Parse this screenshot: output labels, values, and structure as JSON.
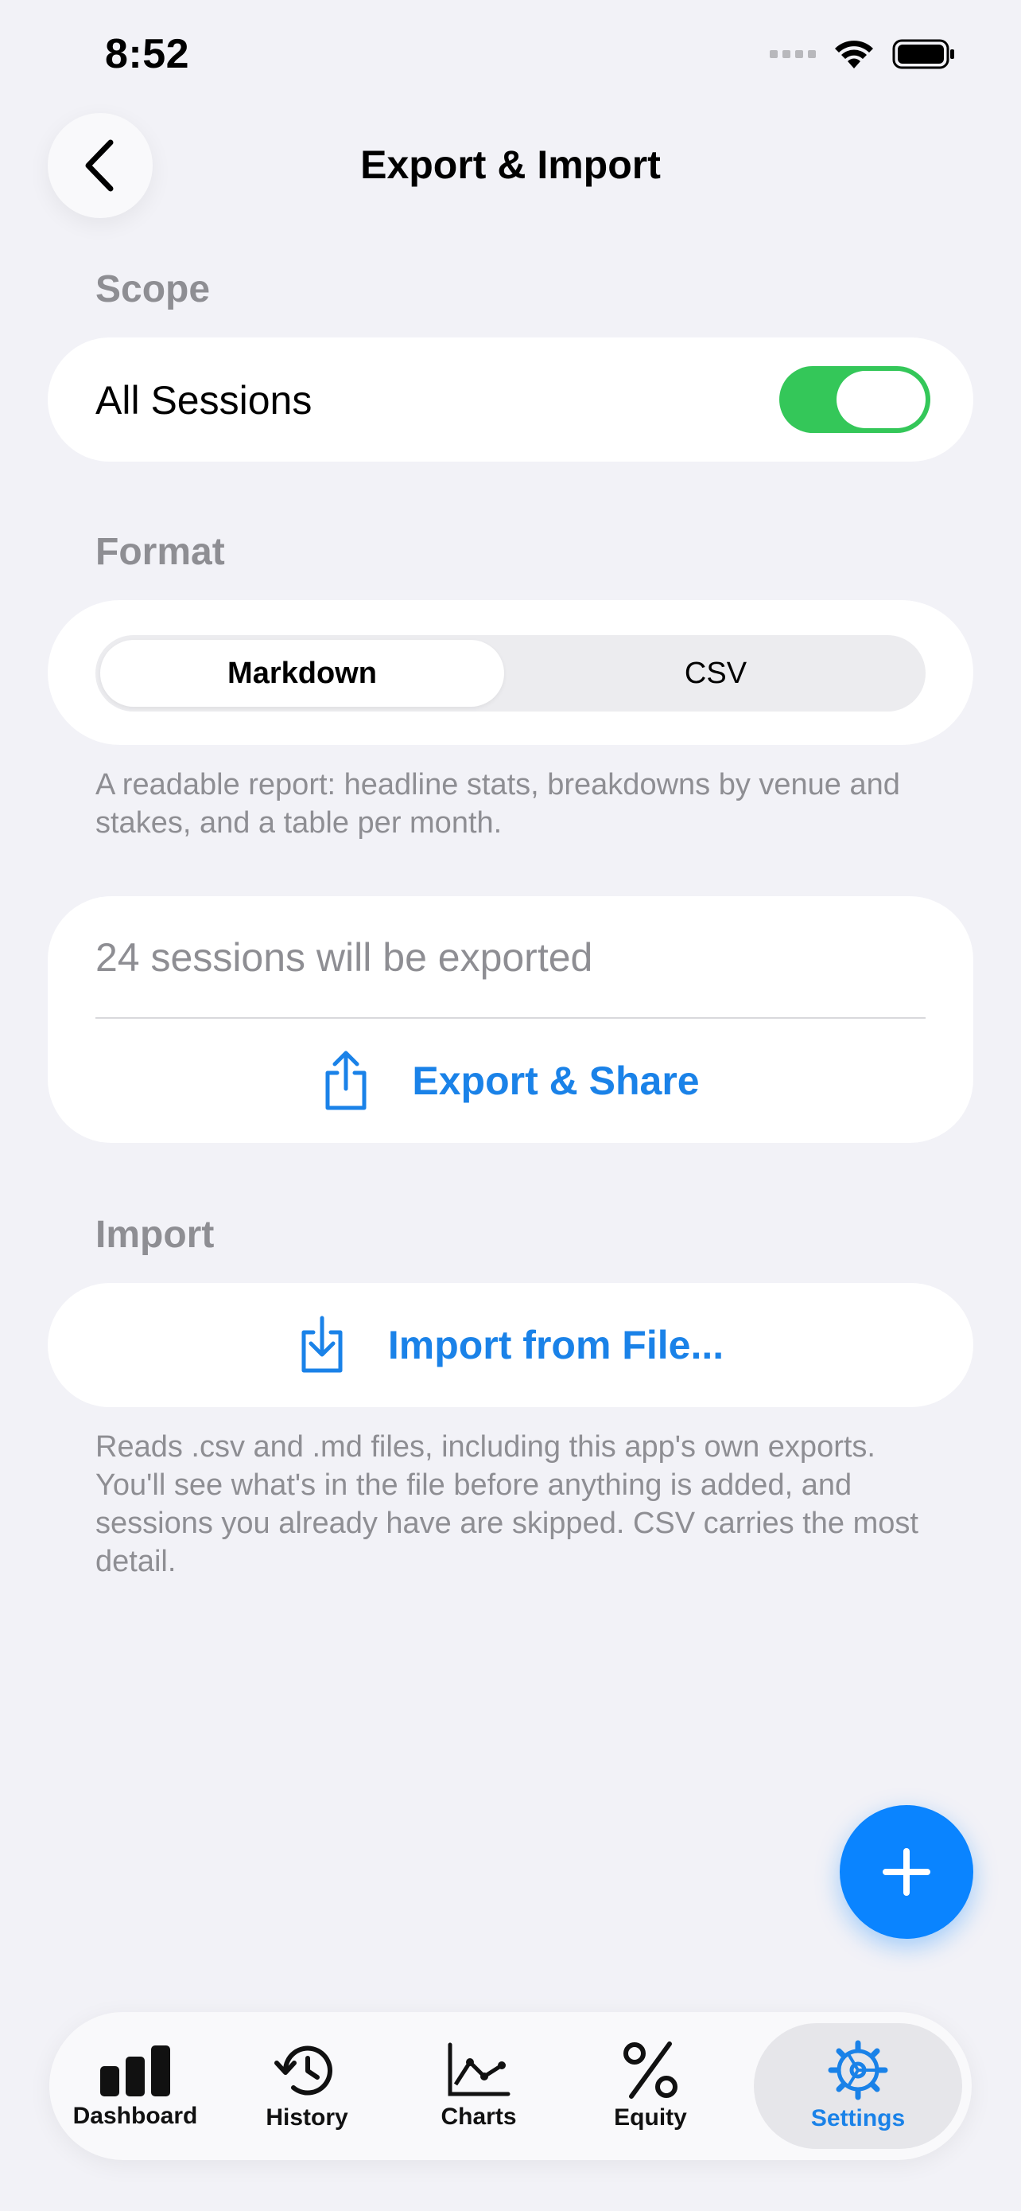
{
  "status_bar": {
    "time": "8:52"
  },
  "nav": {
    "title": "Export & Import"
  },
  "scope": {
    "label": "Scope",
    "row_label": "All Sessions",
    "toggle_on": true
  },
  "format": {
    "label": "Format",
    "options": [
      "Markdown",
      "CSV"
    ],
    "selected": "Markdown",
    "description": "A readable report: headline stats, breakdowns by venue and stakes, and a table per month."
  },
  "export": {
    "count_text": "24 sessions will be exported",
    "button_label": "Export & Share"
  },
  "import": {
    "label": "Import",
    "button_label": "Import from File...",
    "description": "Reads .csv and .md files, including this app's own exports. You'll see what's in the file before anything is added, and sessions you already have are skipped. CSV carries the most detail."
  },
  "tabs": [
    {
      "label": "Dashboard",
      "icon": "bar-chart-icon"
    },
    {
      "label": "History",
      "icon": "history-icon"
    },
    {
      "label": "Charts",
      "icon": "line-chart-icon"
    },
    {
      "label": "Equity",
      "icon": "percent-icon"
    },
    {
      "label": "Settings",
      "icon": "gear-icon",
      "active": true
    }
  ],
  "colors": {
    "accent": "#1a82e8",
    "toggle": "#34c759",
    "fab": "#0a84ff",
    "secondary_text": "#8e8e93",
    "background": "#f2f2f7"
  }
}
